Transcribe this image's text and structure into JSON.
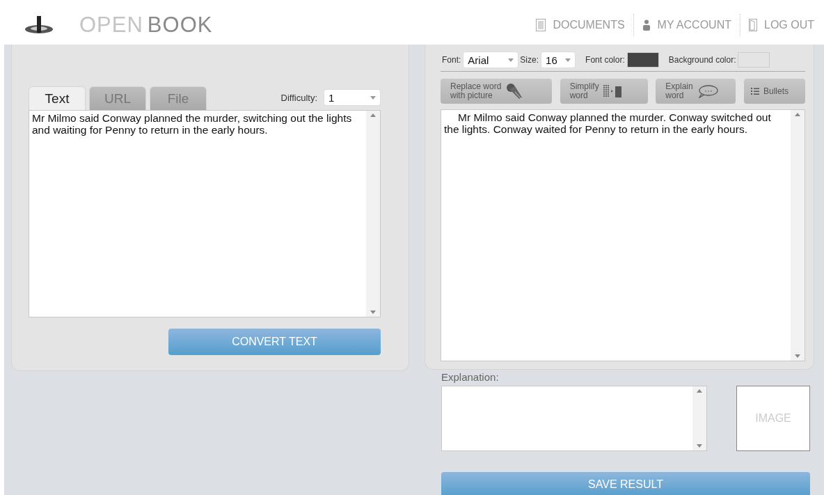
{
  "header": {
    "brand_light": "OPEN",
    "brand_dark": "BOOK",
    "nav": [
      {
        "label": "DOCUMENTS",
        "kind": "documents"
      },
      {
        "label": "MY ACCOUNT",
        "kind": "account"
      },
      {
        "label": "LOG OUT",
        "kind": "logout"
      }
    ]
  },
  "input_panel": {
    "tabs": [
      {
        "label": "Text",
        "selected": true
      },
      {
        "label": "URL",
        "selected": false
      },
      {
        "label": "File",
        "selected": false
      }
    ],
    "difficulty": {
      "label": "Difficulty:",
      "value": "1"
    },
    "text": "Mr Milmo said Conway planned the murder, switching out the lights and waiting for Penny to return in the early hours.",
    "convert_button": "CONVERT TEXT"
  },
  "output_panel": {
    "font": {
      "label": "Font:",
      "value": "Arial"
    },
    "size": {
      "label": "Size:",
      "value": "16"
    },
    "font_color": {
      "label": "Font color:",
      "color": "#444444"
    },
    "background_color": {
      "label": "Background color:",
      "color": "#e4e4e4"
    },
    "tools": [
      {
        "label_lines": [
          "Replace word",
          "with picture"
        ],
        "kind": "picture"
      },
      {
        "label_lines": [
          "Simplify",
          "word"
        ],
        "kind": "simplify"
      },
      {
        "label_lines": [
          "Explain",
          "word"
        ],
        "kind": "explain"
      },
      {
        "label_lines": [
          "Bullets"
        ],
        "kind": "bullets"
      }
    ],
    "text": "Mr Milmo said Conway planned the murder. Conway switched out the lights. Conway waited for Penny to return in the early hours."
  },
  "explanation": {
    "label": "Explanation:",
    "image_placeholder": "IMAGE"
  },
  "save_button": "SAVE RESULT"
}
